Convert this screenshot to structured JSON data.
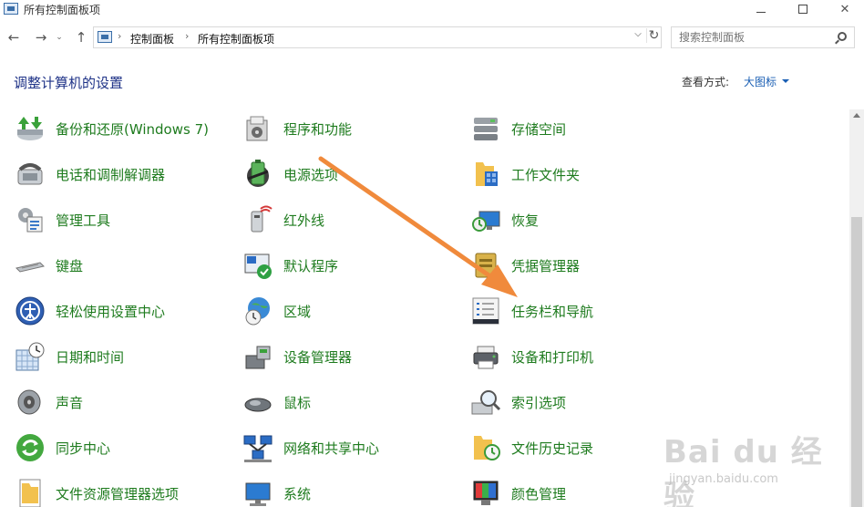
{
  "window": {
    "title": "所有控制面板项",
    "controls": {
      "minimize": "minimize-icon",
      "maximize": "maximize-icon",
      "close": "close-icon"
    }
  },
  "nav": {
    "back": "←",
    "forward": "→",
    "recent": "⌄",
    "up": "↑",
    "breadcrumb": [
      "控制面板",
      "所有控制面板项"
    ],
    "search_placeholder": "搜索控制面板"
  },
  "header": {
    "title": "调整计算机的设置",
    "view_by_label": "查看方式:",
    "view_by_value": "大图标"
  },
  "items": [
    {
      "label": "备份和还原(Windows 7)",
      "icon": "backup-restore-icon"
    },
    {
      "label": "程序和功能",
      "icon": "programs-features-icon"
    },
    {
      "label": "存储空间",
      "icon": "storage-spaces-icon"
    },
    {
      "label": "电话和调制解调器",
      "icon": "phone-modem-icon"
    },
    {
      "label": "电源选项",
      "icon": "power-options-icon"
    },
    {
      "label": "工作文件夹",
      "icon": "work-folders-icon"
    },
    {
      "label": "管理工具",
      "icon": "admin-tools-icon"
    },
    {
      "label": "红外线",
      "icon": "infrared-icon"
    },
    {
      "label": "恢复",
      "icon": "recovery-icon"
    },
    {
      "label": "键盘",
      "icon": "keyboard-icon"
    },
    {
      "label": "默认程序",
      "icon": "default-programs-icon"
    },
    {
      "label": "凭据管理器",
      "icon": "credential-manager-icon"
    },
    {
      "label": "轻松使用设置中心",
      "icon": "ease-of-access-icon"
    },
    {
      "label": "区域",
      "icon": "region-icon"
    },
    {
      "label": "任务栏和导航",
      "icon": "taskbar-navigation-icon"
    },
    {
      "label": "日期和时间",
      "icon": "date-time-icon"
    },
    {
      "label": "设备管理器",
      "icon": "device-manager-icon"
    },
    {
      "label": "设备和打印机",
      "icon": "devices-printers-icon"
    },
    {
      "label": "声音",
      "icon": "sound-icon"
    },
    {
      "label": "鼠标",
      "icon": "mouse-icon"
    },
    {
      "label": "索引选项",
      "icon": "indexing-options-icon"
    },
    {
      "label": "同步中心",
      "icon": "sync-center-icon"
    },
    {
      "label": "网络和共享中心",
      "icon": "network-sharing-icon"
    },
    {
      "label": "文件历史记录",
      "icon": "file-history-icon"
    },
    {
      "label": "文件资源管理器选项",
      "icon": "explorer-options-icon"
    },
    {
      "label": "系统",
      "icon": "system-icon"
    },
    {
      "label": "颜色管理",
      "icon": "color-management-icon"
    }
  ],
  "watermark": {
    "main": "Bai du 经验",
    "sub": "jingyan.baidu.com"
  },
  "colors": {
    "label_green": "#1e7b1e",
    "title_blue": "#1e3287",
    "link_blue": "#1a5fb4",
    "arrow_orange": "#f08a3c"
  }
}
